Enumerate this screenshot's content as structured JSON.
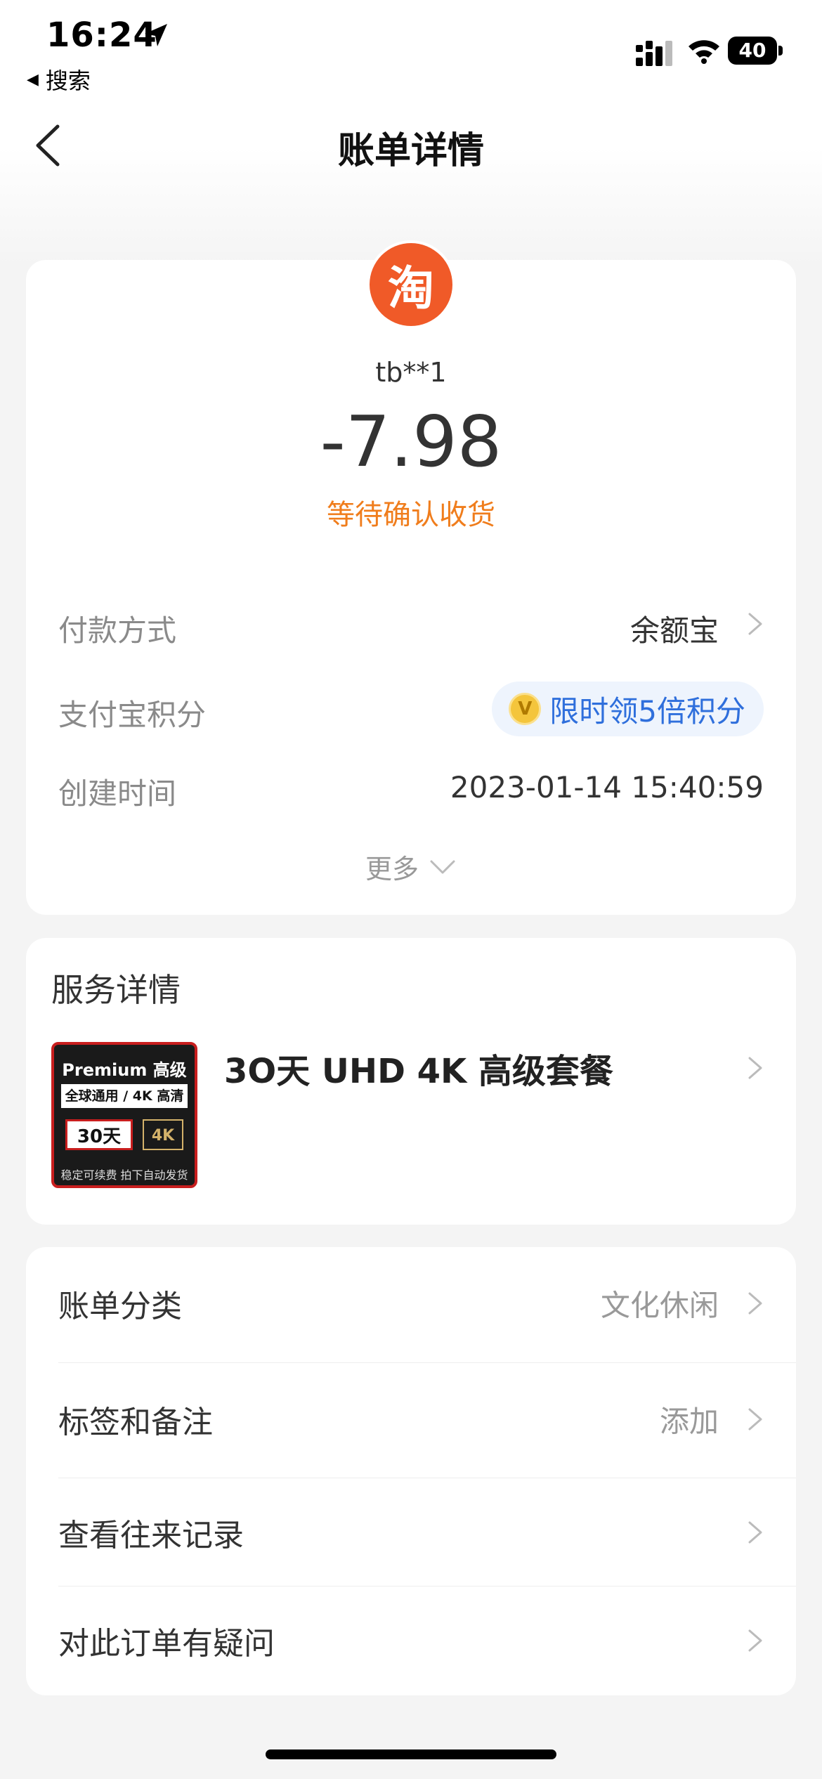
{
  "status_bar": {
    "time": "16:24",
    "back_app": "搜索",
    "battery": "40"
  },
  "nav": {
    "title": "账单详情"
  },
  "summary": {
    "merchant_logo_char": "淘",
    "merchant": "tb**1",
    "amount": "-7.98",
    "status": "等待确认收货"
  },
  "details": {
    "payment_label": "付款方式",
    "payment_value": "余额宝",
    "points_label": "支付宝积分",
    "points_value": "限时领5倍积分",
    "created_label": "创建时间",
    "created_value": "2023-01-14 15:40:59",
    "more_label": "更多"
  },
  "service": {
    "title": "服务详情",
    "product_name": "3O天 UHD 4K 高级套餐",
    "image_text": {
      "line1": "Premium 高级",
      "line2": "全球通用 / 4K 高清",
      "line3": "30天",
      "badge": "4K",
      "line4": "稳定可续费 拍下自动发货"
    }
  },
  "list": [
    {
      "label": "账单分类",
      "value": "文化休闲"
    },
    {
      "label": "标签和备注",
      "value": "添加"
    },
    {
      "label": "查看往来记录",
      "value": ""
    },
    {
      "label": "对此订单有疑问",
      "value": ""
    }
  ],
  "colors": {
    "accent_orange": "#f07d1c",
    "taobao_orange": "#f05a28",
    "link_blue": "#2f6fdc"
  }
}
